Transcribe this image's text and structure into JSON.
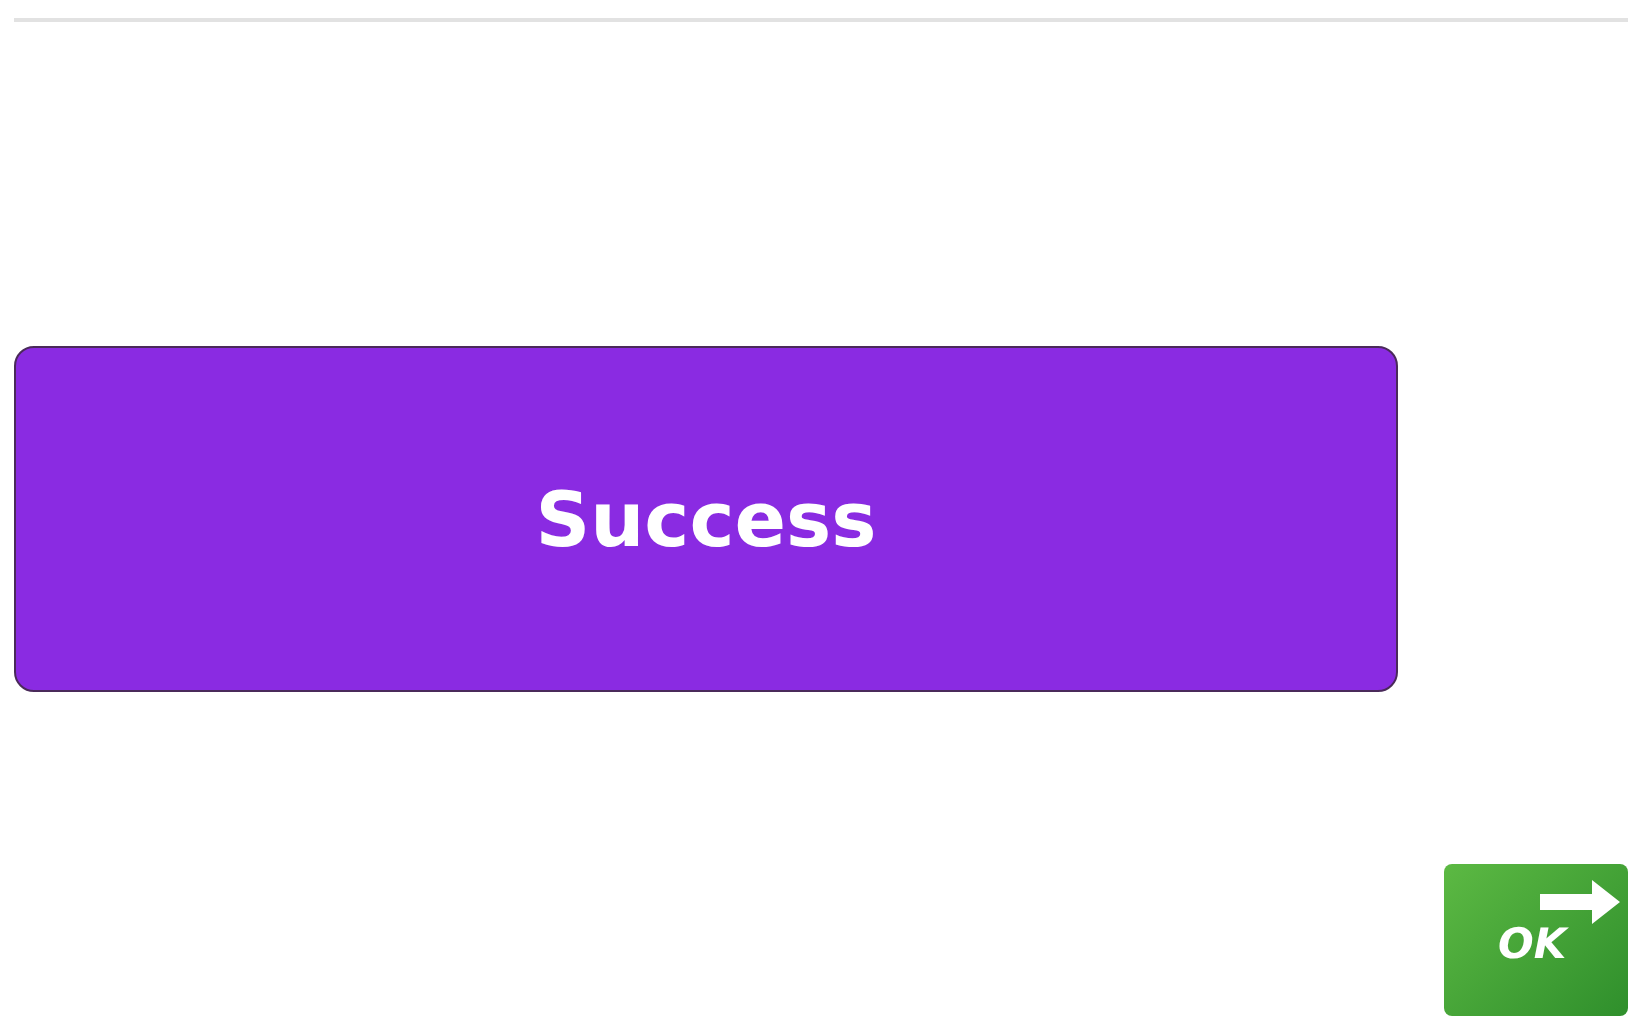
{
  "message": {
    "text": "Success"
  },
  "ok_button": {
    "label": "OK"
  }
}
